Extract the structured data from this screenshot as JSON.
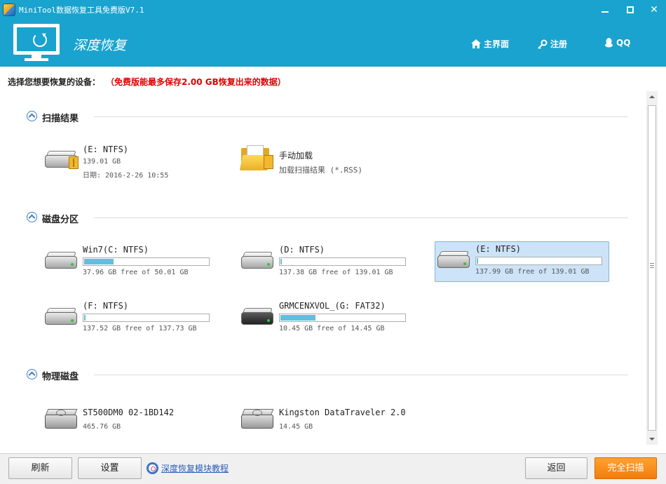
{
  "window": {
    "title": "MiniTool数据恢复工具免费版V7.1"
  },
  "header": {
    "module_title": "深度恢复",
    "nav": {
      "home": "主界面",
      "register": "注册",
      "qq": "QQ"
    },
    "icons": {
      "home": "home-icon",
      "register": "key-icon",
      "qq": "qq-penguin-icon"
    }
  },
  "notice": {
    "prompt": "选择您想要恢复的设备：",
    "limit": "（免费版能最多保存2.00 GB恢复出来的数据）"
  },
  "sections": {
    "scan_results": {
      "label": "扫描结果",
      "items": [
        {
          "name": "(E: NTFS)",
          "size": "139.01 GB",
          "date": "日期: 2016-2-26 10:55"
        },
        {
          "name": "手动加载",
          "sub": "加载扫描结果 (*.RSS)"
        }
      ]
    },
    "partitions": {
      "label": "磁盘分区",
      "items": [
        {
          "name": "Win7(C: NTFS)",
          "free": "37.96 GB free of 50.01 GB",
          "used_fraction": 0.24
        },
        {
          "name": "(D: NTFS)",
          "free": "137.38 GB free of 139.01 GB",
          "used_fraction": 0.01
        },
        {
          "name": "(E: NTFS)",
          "free": "137.99 GB free of 139.01 GB",
          "used_fraction": 0.007,
          "selected": true
        },
        {
          "name": "(F: NTFS)",
          "free": "137.52 GB free of 137.73 GB",
          "used_fraction": 0.002
        },
        {
          "name": "GRMCENXVOL_(G: FAT32)",
          "free": "10.45 GB free of 14.45 GB",
          "used_fraction": 0.28
        }
      ]
    },
    "physical": {
      "label": "物理磁盘",
      "items": [
        {
          "name": "ST500DM0 02-1BD142",
          "size": "465.76 GB"
        },
        {
          "name": "Kingston DataTraveler 2.0",
          "size": "14.45 GB"
        }
      ]
    }
  },
  "footer": {
    "refresh": "刷新",
    "settings": "设置",
    "help_link": "深度恢复模块教程",
    "back": "返回",
    "full_scan": "完全扫描"
  },
  "colors": {
    "header": "#1aa3cf",
    "accent_orange": "#f5860f",
    "warning_red": "#e00000",
    "bar_fill": "#5fbfe0",
    "selected_bg": "#cde3f7"
  }
}
